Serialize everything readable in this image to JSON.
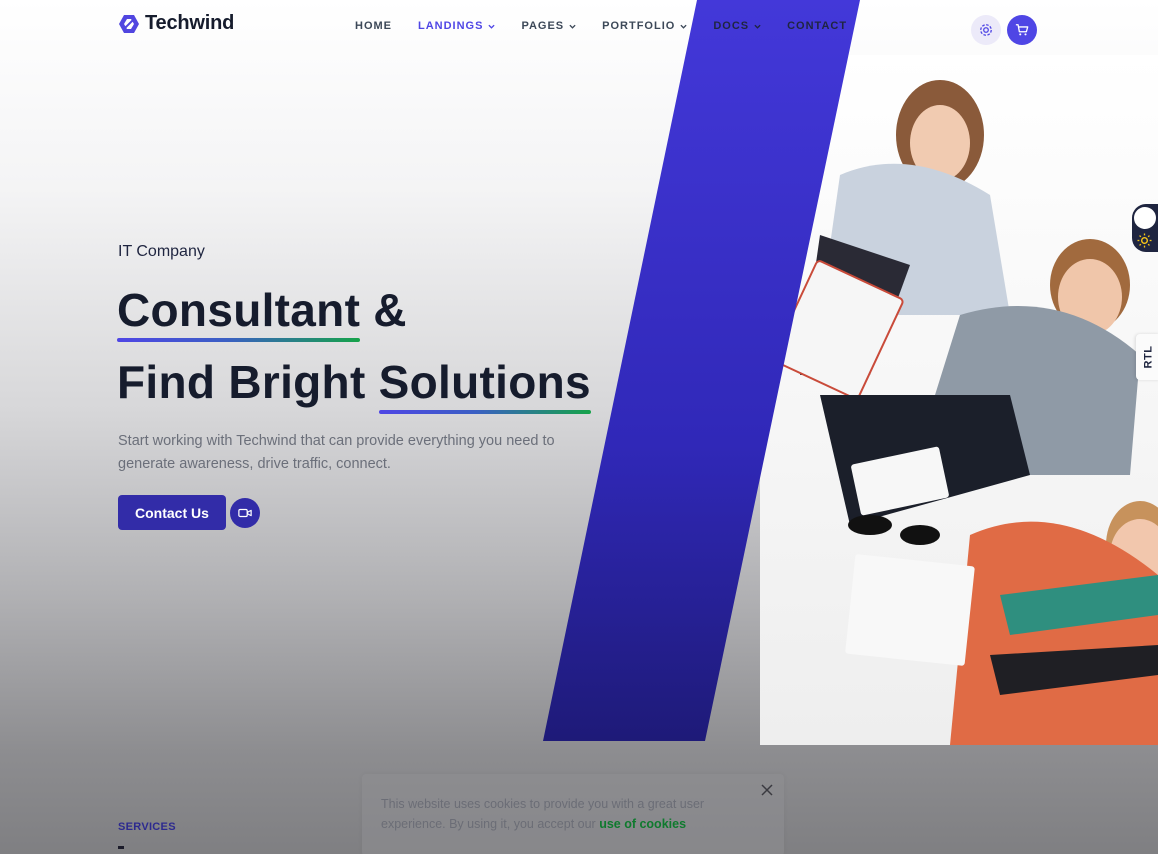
{
  "brand": {
    "name": "Techwind",
    "accent": "#4f46e5",
    "button": "#322ca8"
  },
  "nav": {
    "items": [
      {
        "label": "HOME",
        "dropdown": false,
        "active": false
      },
      {
        "label": "LANDINGS",
        "dropdown": true,
        "active": true
      },
      {
        "label": "PAGES",
        "dropdown": true,
        "active": false
      },
      {
        "label": "PORTFOLIO",
        "dropdown": true,
        "active": false
      },
      {
        "label": "DOCS",
        "dropdown": true,
        "active": false
      },
      {
        "label": "CONTACT",
        "dropdown": false,
        "active": false
      }
    ],
    "icons": [
      "settings-icon",
      "cart-icon"
    ]
  },
  "hero": {
    "eyebrow": "IT Company",
    "headline_line1_highlight": "Consultant",
    "headline_line1_rest": " &",
    "headline_line2_plain": "Find Bright ",
    "headline_line2_highlight": "Solutions",
    "lead": "Start working with Techwind that can provide everything you need to generate awareness, drive traffic, connect.",
    "cta_label": "Contact Us",
    "video_icon": "video-camera-icon"
  },
  "widgets": {
    "mode_icon": "sun-icon",
    "rtl_label": "RTL"
  },
  "section": {
    "services_label": "SERVICES"
  },
  "cookie": {
    "text": "This website uses cookies to provide you with a great user experience. By using it, you accept our ",
    "link": "use of cookies",
    "close_icon": "close-icon"
  }
}
